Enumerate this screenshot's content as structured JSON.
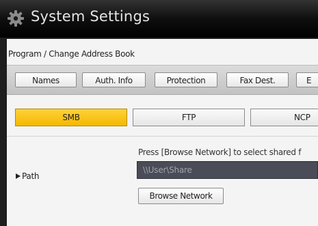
{
  "window": {
    "title": "System Settings",
    "icon": "gear-icon"
  },
  "breadcrumb": "Program / Change Address Book",
  "tabs": [
    {
      "label": "Names"
    },
    {
      "label": "Auth. Info"
    },
    {
      "label": "Protection"
    },
    {
      "label": "Fax Dest."
    },
    {
      "label": "E"
    }
  ],
  "protocols": {
    "selected": "SMB",
    "items": [
      {
        "label": "SMB"
      },
      {
        "label": "FTP"
      },
      {
        "label": "NCP"
      }
    ]
  },
  "path_section": {
    "label": "Path",
    "hint": "Press [Browse Network] to select shared f",
    "value": "\\\\User\\Share",
    "browse_button": "Browse Network"
  },
  "colors": {
    "selected_tab": "#f4b800",
    "title_bar": "#000000",
    "input_background": "#4a4d57"
  }
}
